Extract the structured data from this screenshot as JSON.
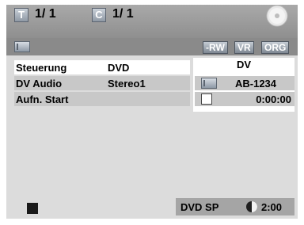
{
  "header": {
    "title_badge": "T",
    "title_value": "1/  1",
    "chapter_badge": "C",
    "chapter_value": "1/  1"
  },
  "format_tags": [
    "-RW",
    "VR",
    "ORG"
  ],
  "menu": [
    {
      "label": "Steuerung",
      "value": "DVD",
      "selected": true
    },
    {
      "label": "DV Audio",
      "value": "Stereo1",
      "selected": false
    },
    {
      "label": "Aufn. Start",
      "value": "",
      "selected": false
    }
  ],
  "device": {
    "source": "DV",
    "tape_id": "AB-1234",
    "timecode": "0:00:00"
  },
  "status": {
    "mode": "DVD SP",
    "remaining": "2:00"
  },
  "icons": {
    "disc": "disc-icon",
    "tape": "tape-icon",
    "stop": "stop-icon",
    "remaining": "pie-icon"
  }
}
